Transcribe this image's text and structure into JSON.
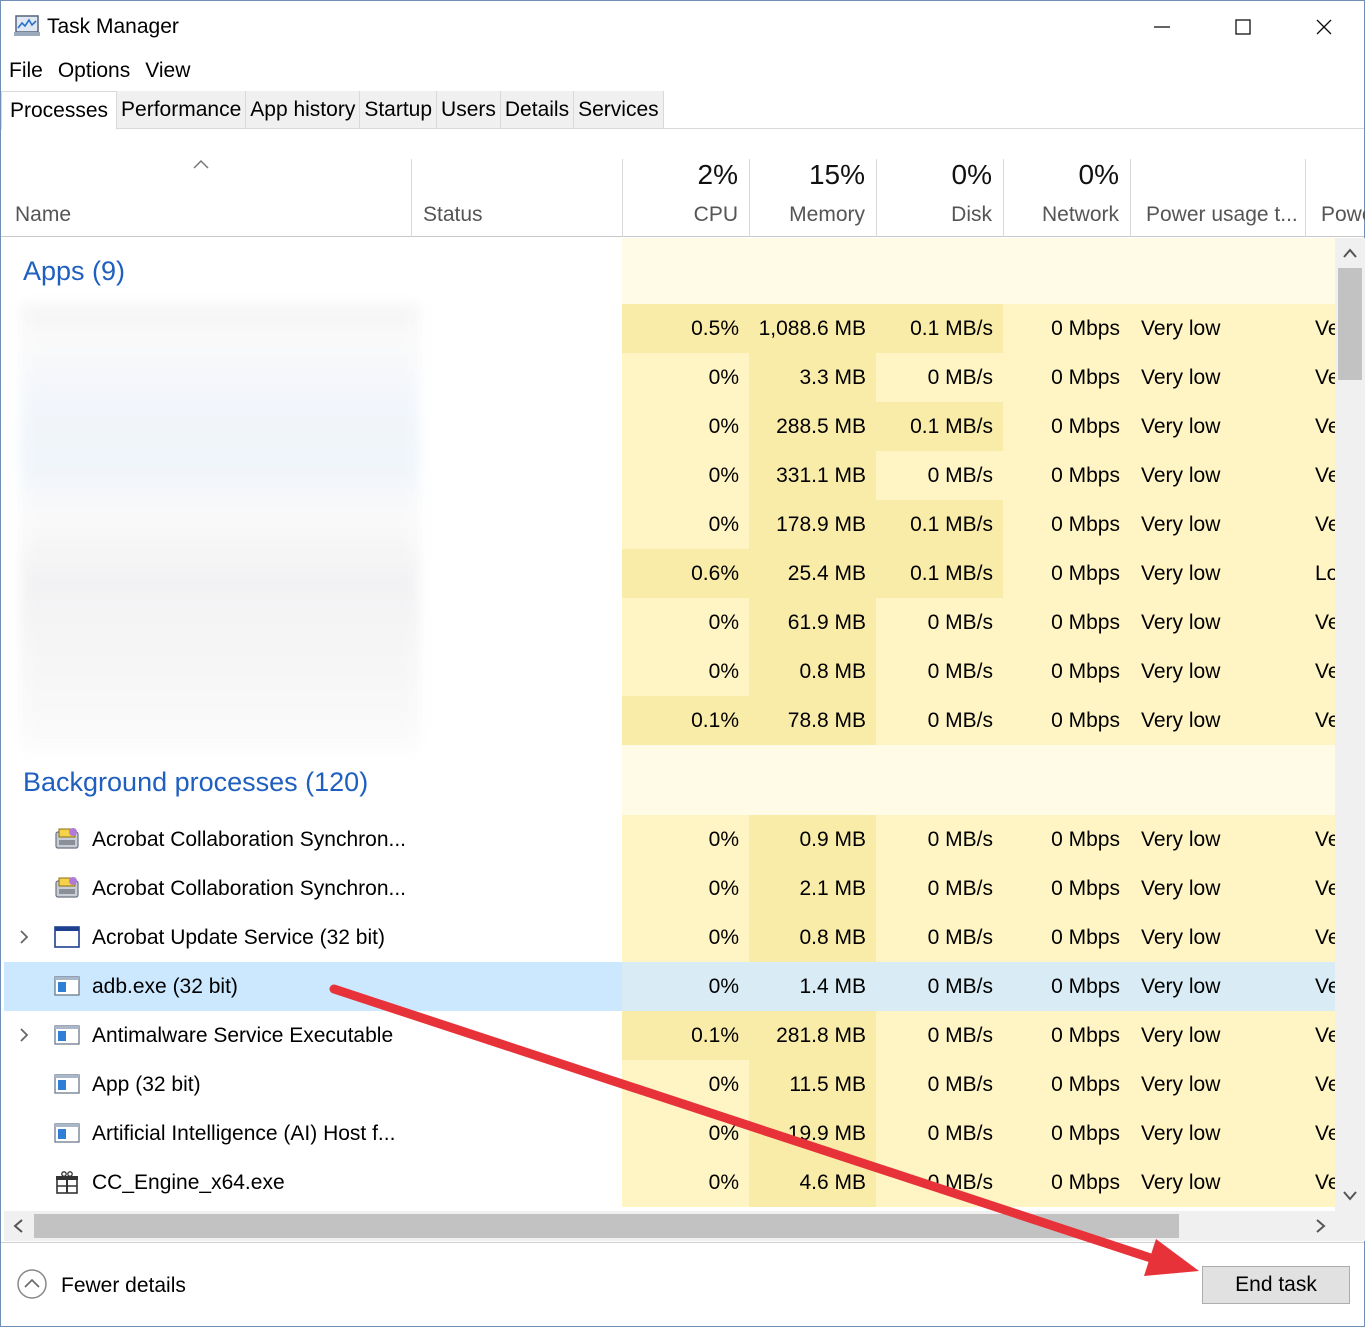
{
  "window": {
    "title": "Task Manager"
  },
  "menu": [
    "File",
    "Options",
    "View"
  ],
  "tabs": [
    "Processes",
    "Performance",
    "App history",
    "Startup",
    "Users",
    "Details",
    "Services"
  ],
  "columns": {
    "name": "Name",
    "status": "Status",
    "cpu": {
      "pct": "2%",
      "label": "CPU"
    },
    "memory": {
      "pct": "15%",
      "label": "Memory"
    },
    "disk": {
      "pct": "0%",
      "label": "Disk"
    },
    "network": {
      "pct": "0%",
      "label": "Network"
    },
    "power": "Power usage t...",
    "power2": "Powe"
  },
  "apps_group": {
    "title": "Apps (9)",
    "rows": [
      {
        "cpu": "0.5%",
        "mem": "1,088.6 MB",
        "disk": "0.1 MB/s",
        "net": "0 Mbps",
        "power": "Very low",
        "power2": "Ve"
      },
      {
        "cpu": "0%",
        "mem": "3.3 MB",
        "disk": "0 MB/s",
        "net": "0 Mbps",
        "power": "Very low",
        "power2": "Ve"
      },
      {
        "cpu": "0%",
        "mem": "288.5 MB",
        "disk": "0.1 MB/s",
        "net": "0 Mbps",
        "power": "Very low",
        "power2": "Ve"
      },
      {
        "cpu": "0%",
        "mem": "331.1 MB",
        "disk": "0 MB/s",
        "net": "0 Mbps",
        "power": "Very low",
        "power2": "Ve"
      },
      {
        "cpu": "0%",
        "mem": "178.9 MB",
        "disk": "0.1 MB/s",
        "net": "0 Mbps",
        "power": "Very low",
        "power2": "Ve"
      },
      {
        "cpu": "0.6%",
        "mem": "25.4 MB",
        "disk": "0.1 MB/s",
        "net": "0 Mbps",
        "power": "Very low",
        "power2": "Lo"
      },
      {
        "cpu": "0%",
        "mem": "61.9 MB",
        "disk": "0 MB/s",
        "net": "0 Mbps",
        "power": "Very low",
        "power2": "Ve"
      },
      {
        "cpu": "0%",
        "mem": "0.8 MB",
        "disk": "0 MB/s",
        "net": "0 Mbps",
        "power": "Very low",
        "power2": "Ve"
      },
      {
        "cpu": "0.1%",
        "mem": "78.8 MB",
        "disk": "0 MB/s",
        "net": "0 Mbps",
        "power": "Very low",
        "power2": "Ve"
      }
    ]
  },
  "bg_group": {
    "title": "Background processes (120)",
    "rows": [
      {
        "name": "Acrobat Collaboration Synchron...",
        "icon": "acrobat-sync-icon",
        "expand": false,
        "cpu": "0%",
        "mem": "0.9 MB",
        "disk": "0 MB/s",
        "net": "0 Mbps",
        "power": "Very low",
        "power2": "Ve"
      },
      {
        "name": "Acrobat Collaboration Synchron...",
        "icon": "acrobat-sync-icon",
        "expand": false,
        "cpu": "0%",
        "mem": "2.1 MB",
        "disk": "0 MB/s",
        "net": "0 Mbps",
        "power": "Very low",
        "power2": "Ve"
      },
      {
        "name": "Acrobat Update Service (32 bit)",
        "icon": "window-icon",
        "expand": true,
        "cpu": "0%",
        "mem": "0.8 MB",
        "disk": "0 MB/s",
        "net": "0 Mbps",
        "power": "Very low",
        "power2": "Ve"
      },
      {
        "name": "adb.exe (32 bit)",
        "icon": "app-window-icon",
        "expand": false,
        "selected": true,
        "cpu": "0%",
        "mem": "1.4 MB",
        "disk": "0 MB/s",
        "net": "0 Mbps",
        "power": "Very low",
        "power2": "Ve"
      },
      {
        "name": "Antimalware Service Executable",
        "icon": "app-window-icon",
        "expand": true,
        "cpu": "0.1%",
        "mem": "281.8 MB",
        "disk": "0 MB/s",
        "net": "0 Mbps",
        "power": "Very low",
        "power2": "Ve"
      },
      {
        "name": "App (32 bit)",
        "icon": "app-window-icon",
        "expand": false,
        "cpu": "0%",
        "mem": "11.5 MB",
        "disk": "0 MB/s",
        "net": "0 Mbps",
        "power": "Very low",
        "power2": "Ve"
      },
      {
        "name": "Artificial Intelligence (AI) Host f...",
        "icon": "app-window-icon",
        "expand": false,
        "cpu": "0%",
        "mem": "19.9 MB",
        "disk": "0 MB/s",
        "net": "0 Mbps",
        "power": "Very low",
        "power2": "Ve"
      },
      {
        "name": "CC_Engine_x64.exe",
        "icon": "gift-icon",
        "expand": false,
        "cpu": "0%",
        "mem": "4.6 MB",
        "disk": "0 MB/s",
        "net": "0 Mbps",
        "power": "Very low",
        "power2": "Ve"
      }
    ]
  },
  "footer": {
    "fewer_details": "Fewer details",
    "end_task": "End task"
  },
  "colors": {
    "accent": "#1f5fbf",
    "selection": "#cce8ff",
    "heat_low": "#fff4c4",
    "heat_mid": "#f9eca8",
    "arrow": "#e8323a"
  }
}
